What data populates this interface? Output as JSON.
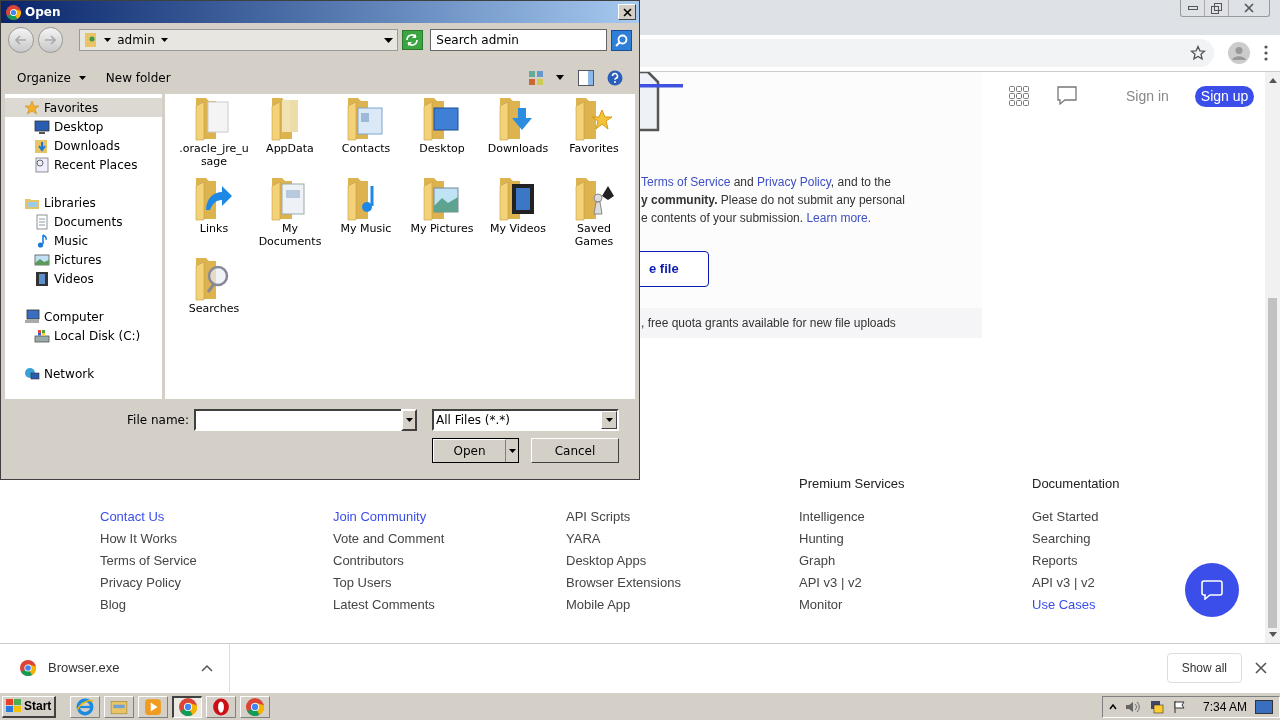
{
  "browser": {
    "header": {
      "signin": "Sign in",
      "signup": "Sign up"
    },
    "notice": [
      {
        "parts": [
          {
            "text": "Terms of Service",
            "link": true
          },
          {
            "text": " and ",
            "link": false
          },
          {
            "text": "Privacy Policy",
            "link": true
          },
          {
            "text": ", and to the",
            "link": false
          }
        ]
      },
      {
        "parts": [
          {
            "text": "y community.",
            "link": false,
            "bold": true
          },
          {
            "text": " Please do not submit any personal",
            "link": false,
            "bold": false
          }
        ]
      },
      {
        "parts": [
          {
            "text": "e contents of your submission. ",
            "link": false
          },
          {
            "text": "Learn more.",
            "link": true
          }
        ]
      }
    ],
    "choose_button": "e file",
    "quota": ", free quota grants available for new file uploads",
    "footer": [
      {
        "links": [
          {
            "text": "Contact Us",
            "highlighted": true
          },
          {
            "text": "How It Works",
            "highlighted": false
          },
          {
            "text": "Terms of Service",
            "highlighted": false
          },
          {
            "text": "Privacy Policy",
            "highlighted": false
          },
          {
            "text": "Blog",
            "highlighted": false
          }
        ]
      },
      {
        "links": [
          {
            "text": "Join Community",
            "highlighted": true
          },
          {
            "text": "Vote and Comment",
            "highlighted": false
          },
          {
            "text": "Contributors",
            "highlighted": false
          },
          {
            "text": "Top Users",
            "highlighted": false
          },
          {
            "text": "Latest Comments",
            "highlighted": false
          }
        ]
      },
      {
        "links": [
          {
            "text": "API Scripts",
            "highlighted": false
          },
          {
            "text": "YARA",
            "highlighted": false
          },
          {
            "text": "Desktop Apps",
            "highlighted": false
          },
          {
            "text": "Browser Extensions",
            "highlighted": false
          },
          {
            "text": "Mobile App",
            "highlighted": false
          }
        ]
      },
      {
        "heading": "Premium Services",
        "links": [
          {
            "text": "Intelligence",
            "highlighted": false
          },
          {
            "text": "Hunting",
            "highlighted": false
          },
          {
            "text": "Graph",
            "highlighted": false
          },
          {
            "text": "API v3 | v2",
            "highlighted": false
          },
          {
            "text": "Monitor",
            "highlighted": false
          }
        ]
      },
      {
        "heading": "Documentation",
        "links": [
          {
            "text": "Get Started",
            "highlighted": false
          },
          {
            "text": "Searching",
            "highlighted": false
          },
          {
            "text": "Reports",
            "highlighted": false
          },
          {
            "text": "API v3 | v2",
            "highlighted": false
          },
          {
            "text": "Use Cases",
            "highlighted": true
          }
        ]
      }
    ],
    "download": {
      "file": "Browser.exe",
      "show_all": "Show all"
    }
  },
  "dialog": {
    "title": "Open",
    "location": "admin",
    "search": {
      "placeholder": "Search admin"
    },
    "toolbar": [
      "Organize",
      "New folder"
    ],
    "sidebar": [
      {
        "label": "Favorites",
        "kind": "star",
        "selected": true,
        "children": [
          {
            "label": "Desktop",
            "kind": "desktop",
            "selected": false
          },
          {
            "label": "Downloads",
            "kind": "downloads",
            "selected": false
          },
          {
            "label": "Recent Places",
            "kind": "recent",
            "selected": false
          }
        ]
      },
      {
        "label": "Libraries",
        "kind": "libraries",
        "selected": false,
        "children": [
          {
            "label": "Documents",
            "kind": "documents",
            "selected": false
          },
          {
            "label": "Music",
            "kind": "music",
            "selected": false
          },
          {
            "label": "Pictures",
            "kind": "pictures",
            "selected": false
          },
          {
            "label": "Videos",
            "kind": "videos",
            "selected": false
          }
        ]
      },
      {
        "label": "Computer",
        "kind": "computer",
        "selected": false,
        "children": [
          {
            "label": "Local Disk (C:)",
            "kind": "disk",
            "selected": false
          }
        ]
      },
      {
        "label": "Network",
        "kind": "network",
        "selected": false
      }
    ],
    "items": [
      {
        "name": ".oracle_jre_usage",
        "kind": "blank"
      },
      {
        "name": "AppData",
        "kind": "appdata"
      },
      {
        "name": "Contacts",
        "kind": "contacts"
      },
      {
        "name": "Desktop",
        "kind": "desktop"
      },
      {
        "name": "Downloads",
        "kind": "downloads"
      },
      {
        "name": "Favorites",
        "kind": "favorites"
      },
      {
        "name": "Links",
        "kind": "links"
      },
      {
        "name": "My Documents",
        "kind": "documents"
      },
      {
        "name": "My Music",
        "kind": "music"
      },
      {
        "name": "My Pictures",
        "kind": "pictures"
      },
      {
        "name": "My Videos",
        "kind": "videos"
      },
      {
        "name": "Saved Games",
        "kind": "games"
      },
      {
        "name": "Searches",
        "kind": "searches"
      }
    ],
    "file_name_label": "File name:",
    "file_type": "All Files (*.*)",
    "buttons": [
      "Open",
      "Cancel"
    ]
  },
  "taskbar": {
    "start": "Start",
    "apps": [
      {
        "kind": "ie",
        "selected": false
      },
      {
        "kind": "explorer",
        "selected": false
      },
      {
        "kind": "media",
        "selected": false
      },
      {
        "kind": "chrome",
        "selected": true
      },
      {
        "kind": "opera",
        "selected": false
      },
      {
        "kind": "chrome",
        "selected": false
      }
    ],
    "clock": "7:34 AM"
  }
}
